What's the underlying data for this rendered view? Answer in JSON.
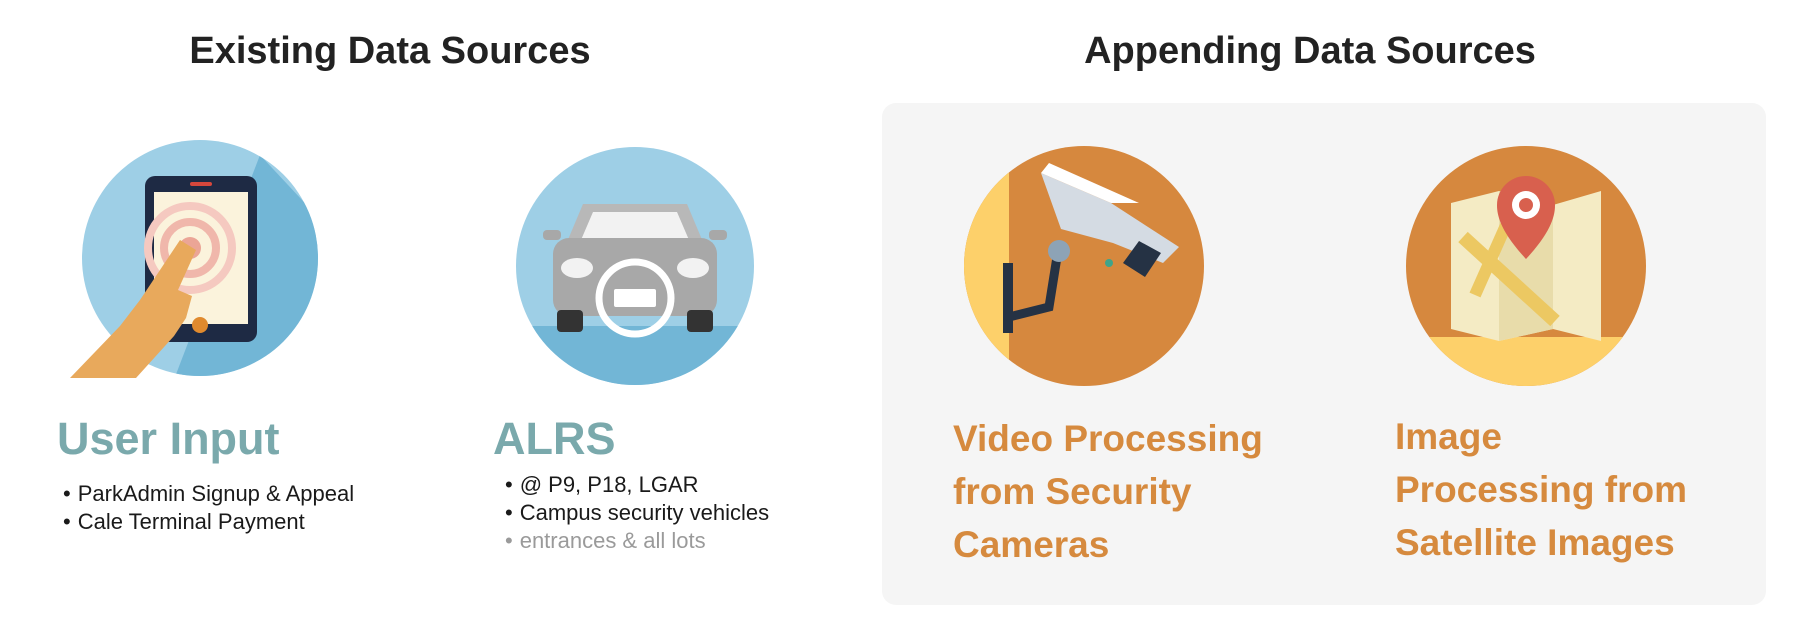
{
  "headings": {
    "existing": "Existing Data Sources",
    "appending": "Appending Data Sources"
  },
  "sources": {
    "user_input": {
      "title": "User Input",
      "bullets": [
        "ParkAdmin Signup & Appeal",
        "Cale Terminal Payment"
      ],
      "icon": "tablet-tap-icon"
    },
    "alrs": {
      "title": "ALRS",
      "bullets": [
        "@ P9, P18, LGAR",
        "Campus security vehicles",
        "entrances & all lots"
      ],
      "icon": "car-license-plate-icon"
    },
    "video": {
      "title_lines": [
        "Video Processing",
        "from Security",
        "Cameras"
      ],
      "icon": "security-camera-icon"
    },
    "image": {
      "title_lines": [
        "Image",
        "Processing from",
        "Satellite Images"
      ],
      "icon": "map-pin-icon"
    }
  },
  "colors": {
    "teal": "#7aa9ac",
    "orange": "#d68a3e",
    "light_blue": "#9ecfe6",
    "panel_bg": "#f5f5f5"
  }
}
